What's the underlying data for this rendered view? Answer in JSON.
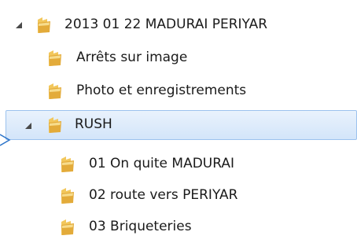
{
  "tree": {
    "items": [
      {
        "label": "2013 01 22 MADURAI PERIYAR",
        "expanded": true,
        "selected": false,
        "level": 0
      },
      {
        "label": "Arrêts sur image",
        "expanded": false,
        "selected": false,
        "level": 1
      },
      {
        "label": "Photo et enregistrements",
        "expanded": false,
        "selected": false,
        "level": 1
      },
      {
        "label": "RUSH",
        "expanded": true,
        "selected": true,
        "level": 1
      },
      {
        "label": "01 On quite MADURAI",
        "expanded": false,
        "selected": false,
        "level": 2
      },
      {
        "label": "02 route vers PERIYAR",
        "expanded": false,
        "selected": false,
        "level": 2
      },
      {
        "label": "03 Briqueteries",
        "expanded": false,
        "selected": false,
        "level": 2
      }
    ]
  },
  "icons": {
    "folder": "folder-icon",
    "expand": "expanded-arrow-icon",
    "pointer": "pointer-arrow-icon"
  },
  "colors": {
    "selection_fill": "#d9e9fb",
    "selection_border": "#9cc2ee",
    "folder": "#e6b84a",
    "text": "#1a1a1a"
  }
}
